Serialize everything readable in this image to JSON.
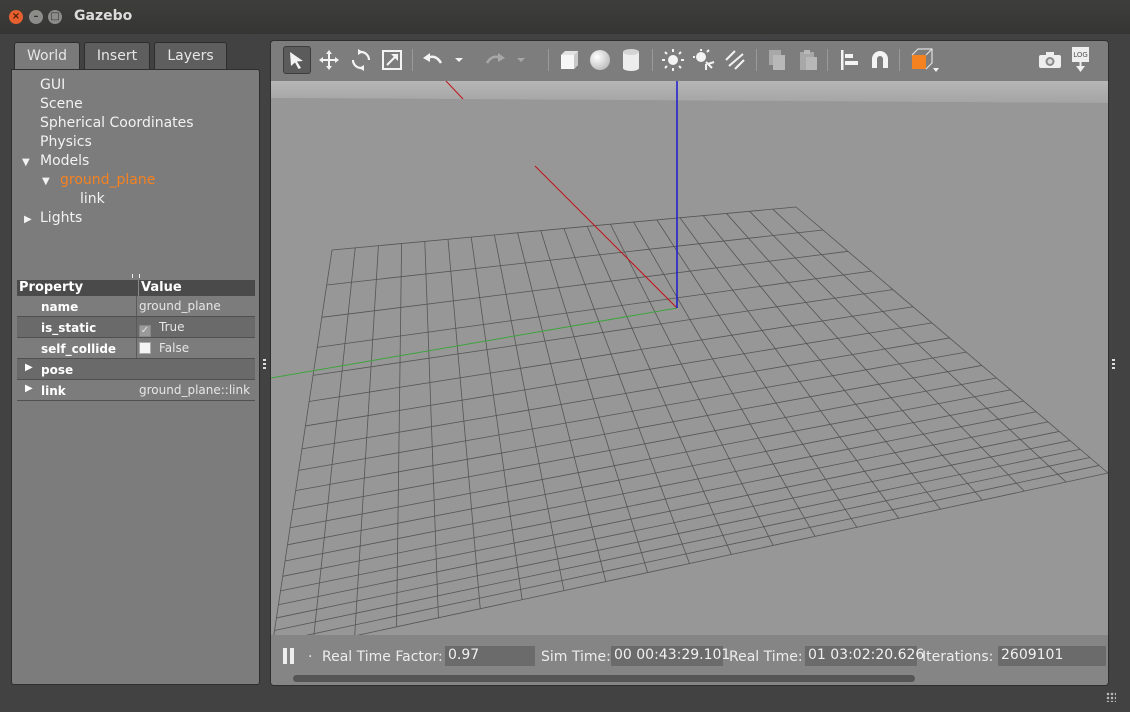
{
  "window": {
    "title": "Gazebo",
    "close_glyph": "×",
    "min_glyph": "–",
    "max_glyph": "□"
  },
  "left_tabs": [
    {
      "label": "World",
      "active": true
    },
    {
      "label": "Insert",
      "active": false
    },
    {
      "label": "Layers",
      "active": false
    }
  ],
  "world_tree": [
    {
      "label": "GUI",
      "arrow": "",
      "level": 0,
      "selected": false
    },
    {
      "label": "Scene",
      "arrow": "",
      "level": 0,
      "selected": false
    },
    {
      "label": "Spherical Coordinates",
      "arrow": "",
      "level": 0,
      "selected": false
    },
    {
      "label": "Physics",
      "arrow": "",
      "level": 0,
      "selected": false
    },
    {
      "label": "Models",
      "arrow": "▼",
      "level": 0,
      "selected": false
    },
    {
      "label": "ground_plane",
      "arrow": "▼",
      "level": 1,
      "selected": true
    },
    {
      "label": "link",
      "arrow": "",
      "level": 2,
      "selected": false
    },
    {
      "label": "Lights",
      "arrow": "▶",
      "level": 0,
      "selected": false
    }
  ],
  "properties": {
    "header_property": "Property",
    "header_value": "Value",
    "rows": [
      {
        "key": "name",
        "value": "ground_plane",
        "type": "text"
      },
      {
        "key": "is_static",
        "value": "True",
        "type": "checkbox",
        "checked": true
      },
      {
        "key": "self_collide",
        "value": "False",
        "type": "checkbox",
        "checked": false
      },
      {
        "key": "pose",
        "value": "",
        "type": "expander"
      },
      {
        "key": "link",
        "value": "ground_plane::link",
        "type": "expander"
      }
    ]
  },
  "toolbar": {
    "tools": [
      "select-arrow-icon",
      "translate-icon",
      "rotate-icon",
      "scale-icon",
      "undo-icon",
      "undo-dropdown-icon",
      "redo-icon",
      "redo-dropdown-icon",
      "box-icon",
      "sphere-icon",
      "cylinder-icon",
      "point-light-icon",
      "spot-light-icon",
      "directional-light-icon",
      "copy-icon",
      "paste-icon",
      "align-icon",
      "snap-icon",
      "view-angle-icon",
      "screenshot-icon",
      "log-icon"
    ],
    "log_label": "LOG"
  },
  "statusbar": {
    "step_label": ".",
    "real_time_factor_label": "Real Time Factor:",
    "real_time_factor": "0.97",
    "sim_time_label": "Sim Time:",
    "sim_time": "00 00:43:29.101",
    "real_time_label": "Real Time:",
    "real_time": "01 03:02:20.626",
    "iterations_label": "Iterations:",
    "iterations": "2609101"
  },
  "colors": {
    "accent": "#f58220",
    "axis_x": "#c0141a",
    "axis_y": "#3fa33f",
    "axis_z": "#1a1ad0"
  }
}
